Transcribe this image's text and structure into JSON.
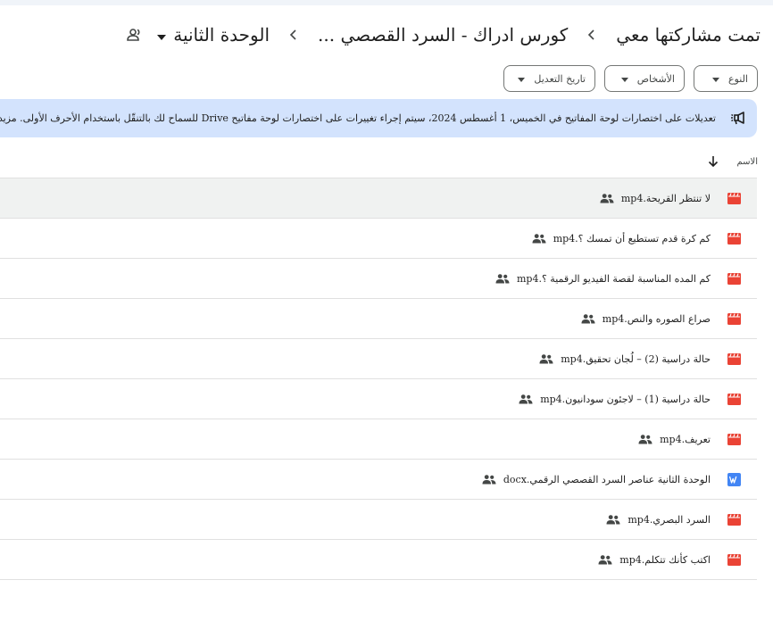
{
  "breadcrumb": {
    "root": "تمت مشاركتها معي",
    "parent": "كورس ادراك - السرد القصصي ...",
    "current": "الوحدة الثانية"
  },
  "filters": [
    {
      "label": "النوع"
    },
    {
      "label": "الأشخاص"
    },
    {
      "label": "تاريخ التعديل"
    }
  ],
  "banner": {
    "text": "تعديلات على اختصارات لوحة المفاتيح في الخميس، 1 أغسطس 2024، سيتم إجراء تغييرات على اختصارات لوحة مفاتيح Drive للسماح لك بالتنقّل باستخدام الأحرف الأولى. مزيد من المعلومات"
  },
  "list": {
    "header_name": "الاسم",
    "files": [
      {
        "name": "لا تنتظر القريحة.mp4",
        "type": "video"
      },
      {
        "name": "كم كرة قدم تستطيع أن تمسك ؟.mp4",
        "type": "video"
      },
      {
        "name": "كم المده المناسبة لقصة الفيديو الرقمية ؟.mp4",
        "type": "video"
      },
      {
        "name": "صراع الصوره والنص.mp4",
        "type": "video"
      },
      {
        "name": "حالة دراسية (2) – لُجان تحقيق.mp4",
        "type": "video"
      },
      {
        "name": "حالة دراسية (1) – لاجئون سودانيون.mp4",
        "type": "video"
      },
      {
        "name": "تعريف.mp4",
        "type": "video"
      },
      {
        "name": "الوحدة الثانية عناصر السرد القصصي الرقمي.docx",
        "type": "doc"
      },
      {
        "name": "السرد البصري.mp4",
        "type": "video"
      },
      {
        "name": "اكتب كأنك تتكلم.mp4",
        "type": "video"
      }
    ]
  },
  "colors": {
    "video_icon": "#ea4335",
    "doc_icon": "#4285f4",
    "banner_bg": "#d3e3fd",
    "selected_row": "#f0f2f1"
  },
  "icons": {
    "video": "video-file-icon",
    "doc": "docs-file-icon",
    "shared": "shared-people-icon",
    "megaphone": "megaphone-icon"
  }
}
